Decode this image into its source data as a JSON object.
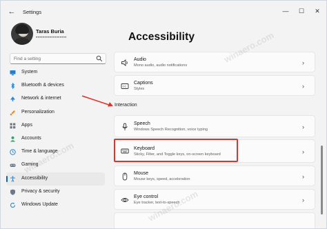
{
  "window": {
    "title": "Settings",
    "back_glyph": "←",
    "minimize_glyph": "—",
    "maximize_glyph": "☐",
    "close_glyph": "✕"
  },
  "profile": {
    "name": "Taras Buria",
    "email": "••••••••••••••••••"
  },
  "search": {
    "placeholder": "Find a setting"
  },
  "sidebar": {
    "items": [
      {
        "label": "System",
        "icon": "monitor-icon",
        "active": false
      },
      {
        "label": "Bluetooth & devices",
        "icon": "bluetooth-icon",
        "active": false
      },
      {
        "label": "Network & internet",
        "icon": "network-icon",
        "active": false
      },
      {
        "label": "Personalization",
        "icon": "brush-icon",
        "active": false
      },
      {
        "label": "Apps",
        "icon": "apps-icon",
        "active": false
      },
      {
        "label": "Accounts",
        "icon": "person-icon",
        "active": false
      },
      {
        "label": "Time & language",
        "icon": "globe-clock-icon",
        "active": false
      },
      {
        "label": "Gaming",
        "icon": "gamepad-icon",
        "active": false
      },
      {
        "label": "Accessibility",
        "icon": "accessibility-icon",
        "active": true
      },
      {
        "label": "Privacy & security",
        "icon": "shield-icon",
        "active": false
      },
      {
        "label": "Windows Update",
        "icon": "update-icon",
        "active": false
      }
    ]
  },
  "main": {
    "page_title": "Accessibility",
    "section_label": "Interaction",
    "cards": [
      {
        "title": "Audio",
        "desc": "Mono audio, audio notifications",
        "icon": "speaker-icon"
      },
      {
        "title": "Captions",
        "desc": "Styles",
        "icon": "captions-icon"
      },
      {
        "title": "Speech",
        "desc": "Windows Speech Recognition, voice typing",
        "icon": "microphone-icon"
      },
      {
        "title": "Keyboard",
        "desc": "Sticky, Filter, and Toggle keys, on-screen keyboard",
        "icon": "keyboard-icon"
      },
      {
        "title": "Mouse",
        "desc": "Mouse keys, speed, acceleration",
        "icon": "mouse-icon"
      },
      {
        "title": "Eye control",
        "desc": "Eye tracker, text-to-speech",
        "icon": "eye-icon"
      }
    ],
    "chevron_glyph": "›"
  },
  "watermark": {
    "text": "winaero.com"
  },
  "colors": {
    "accent": "#0067c0",
    "annotation_red": "#e0312b",
    "window_bg": "#f3f3f3",
    "card_bg": "#fbfbfb"
  }
}
